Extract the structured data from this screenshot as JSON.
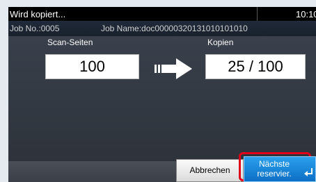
{
  "header": {
    "status": "Wird kopiert...",
    "time": "10:10"
  },
  "job": {
    "number": "Job No.:0005",
    "name": "Job Name:doc00000320131010101010"
  },
  "counts": {
    "scan_label": "Scan-Seiten",
    "scan_value": "100",
    "copies_label": "Kopien",
    "copies_value": "25 / 100"
  },
  "footer": {
    "cancel_label": "Abbrechen",
    "next_label_line1": "Nächste",
    "next_label_line2": "reservier."
  },
  "icons": {
    "arrow": "right-arrow-icon",
    "enter": "enter-icon"
  },
  "colors": {
    "highlight": "#e0001a",
    "primary_button": "#1a86d8"
  }
}
